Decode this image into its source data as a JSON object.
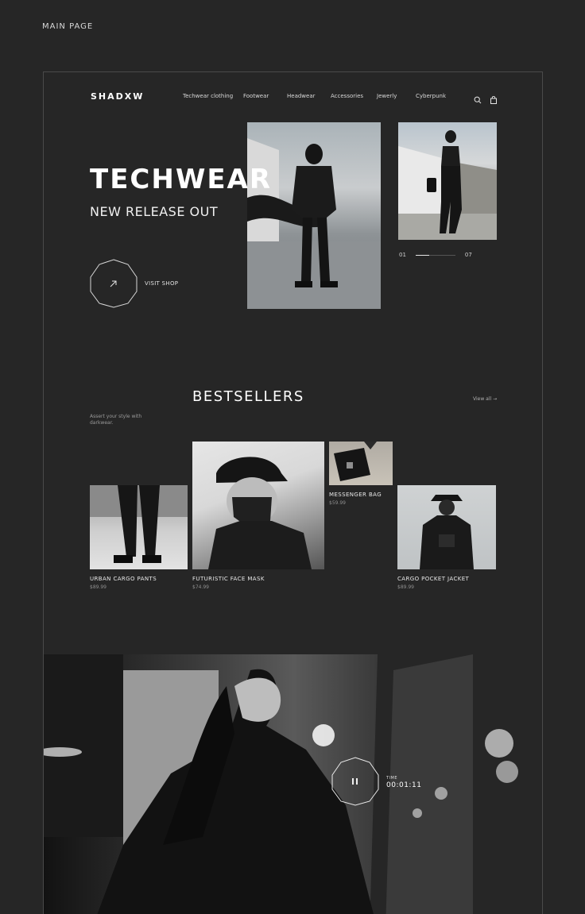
{
  "page_label": "MAIN PAGE",
  "header": {
    "logo": "SHADXW",
    "nav": [
      "Techwear clothing",
      "Footwear",
      "Headwear",
      "Accessories",
      "Jewerly",
      "Cyberpunk"
    ],
    "icons": [
      "search-icon",
      "shopping-bag-icon"
    ]
  },
  "hero": {
    "title": "TECHWEAR",
    "subtitle": "NEW RELEASE OUT",
    "cta_label": "VISIT SHOP",
    "cta_icon": "arrow-up-right-icon",
    "counter_current": "01",
    "counter_total": "07",
    "progress_fraction": 0.35
  },
  "bestsellers": {
    "title": "BESTSELLERS",
    "description": "Assert your style with darkwear.",
    "view_all": "View all →",
    "products": [
      {
        "name": "URBAN CARGO PANTS",
        "price": "$89.99"
      },
      {
        "name": "FUTURISTIC FACE MASK",
        "price": "$74.99"
      },
      {
        "name": "MESSENGER BAG",
        "price": "$59.99"
      },
      {
        "name": "CARGO POCKET JACKET",
        "price": "$89.99"
      }
    ]
  },
  "video": {
    "control_icon": "pause-icon",
    "time_label": "TIME",
    "time_value": "00:01:11"
  },
  "colors": {
    "background": "#262626",
    "frame_border": "#4a4a4a",
    "text": "#ffffff",
    "muted": "#8e8e8e"
  }
}
